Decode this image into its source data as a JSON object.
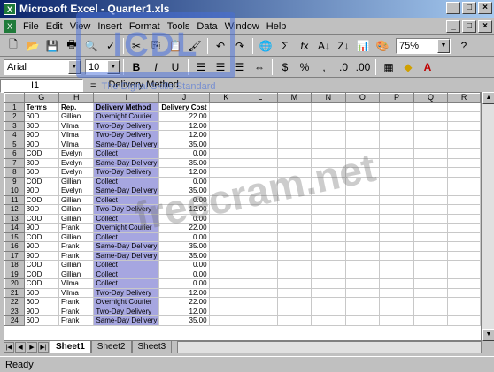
{
  "window": {
    "title": "Microsoft Excel - Quarter1.xls",
    "app_icon": "excel-icon"
  },
  "menu": [
    "File",
    "Edit",
    "View",
    "Insert",
    "Format",
    "Tools",
    "Data",
    "Window",
    "Help"
  ],
  "toolbar": {
    "zoom": "75%",
    "font": "Arial",
    "size": "10"
  },
  "formula": {
    "cell": "I1",
    "fx": "=",
    "content": "Delivery Method"
  },
  "columns": [
    "G",
    "H",
    "I",
    "J",
    "K",
    "L",
    "M",
    "N",
    "O",
    "P",
    "Q",
    "R"
  ],
  "headers": {
    "terms": "Terms",
    "rep": "Rep.",
    "method": "Delivery Method",
    "cost": "Delivery Cost"
  },
  "rows": [
    [
      "1",
      "Terms",
      "Rep.",
      "Delivery Method",
      "Delivery Cost"
    ],
    [
      "2",
      "60D",
      "Gillian",
      "Overnight Courier",
      "22.00"
    ],
    [
      "3",
      "30D",
      "Vilma",
      "Two-Day Delivery",
      "12.00"
    ],
    [
      "4",
      "90D",
      "Vilma",
      "Two-Day Delivery",
      "12.00"
    ],
    [
      "5",
      "90D",
      "Vilma",
      "Same-Day Delivery",
      "35.00"
    ],
    [
      "6",
      "COD",
      "Evelyn",
      "Collect",
      "0.00"
    ],
    [
      "7",
      "30D",
      "Evelyn",
      "Same-Day Delivery",
      "35.00"
    ],
    [
      "8",
      "60D",
      "Evelyn",
      "Two-Day Delivery",
      "12.00"
    ],
    [
      "9",
      "COD",
      "Gillian",
      "Collect",
      "0.00"
    ],
    [
      "10",
      "90D",
      "Evelyn",
      "Same-Day Delivery",
      "35.00"
    ],
    [
      "11",
      "COD",
      "Gillian",
      "Collect",
      "0.00"
    ],
    [
      "12",
      "30D",
      "Gillian",
      "Two-Day Delivery",
      "12.00"
    ],
    [
      "13",
      "COD",
      "Gillian",
      "Collect",
      "0.00"
    ],
    [
      "14",
      "90D",
      "Frank",
      "Overnight Courier",
      "22.00"
    ],
    [
      "15",
      "COD",
      "Gillian",
      "Collect",
      "0.00"
    ],
    [
      "16",
      "90D",
      "Frank",
      "Same-Day Delivery",
      "35.00"
    ],
    [
      "17",
      "90D",
      "Frank",
      "Same-Day Delivery",
      "35.00"
    ],
    [
      "18",
      "COD",
      "Gillian",
      "Collect",
      "0.00"
    ],
    [
      "19",
      "COD",
      "Gillian",
      "Collect",
      "0.00"
    ],
    [
      "20",
      "COD",
      "Vilma",
      "Collect",
      "0.00"
    ],
    [
      "21",
      "60D",
      "Vilma",
      "Two-Day Delivery",
      "12.00"
    ],
    [
      "22",
      "60D",
      "Frank",
      "Overnight Courier",
      "22.00"
    ],
    [
      "23",
      "90D",
      "Frank",
      "Two-Day Delivery",
      "12.00"
    ],
    [
      "24",
      "60D",
      "Frank",
      "Same-Day Delivery",
      "35.00"
    ]
  ],
  "sheets": [
    "Sheet1",
    "Sheet2",
    "Sheet3"
  ],
  "status": "Ready",
  "watermarks": {
    "logo_sub": "The Digital Skills Standard",
    "site": "freecram.net"
  }
}
